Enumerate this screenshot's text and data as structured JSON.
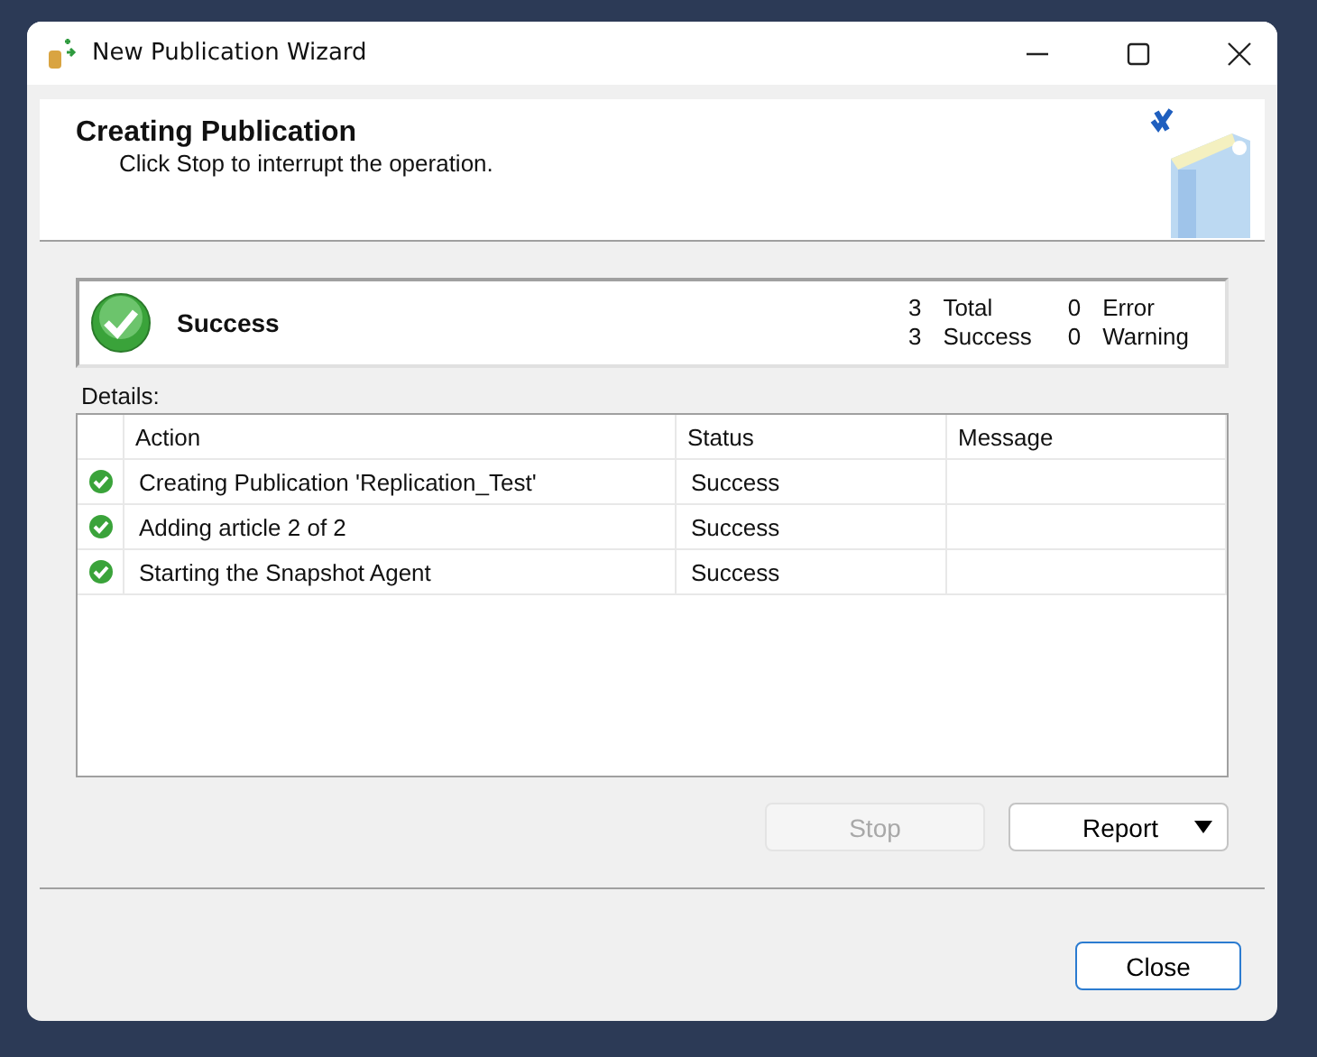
{
  "window": {
    "title": "New Publication Wizard"
  },
  "header": {
    "title": "Creating Publication",
    "subtitle": "Click Stop to interrupt the operation."
  },
  "summary": {
    "kind": "success",
    "label": "Success",
    "counts": [
      {
        "count": "3",
        "label": "Total"
      },
      {
        "count": "0",
        "label": "Error"
      },
      {
        "count": "3",
        "label": "Success"
      },
      {
        "count": "0",
        "label": "Warning"
      }
    ]
  },
  "details": {
    "label": "Details:",
    "columns": [
      "Action",
      "Status",
      "Message"
    ],
    "rows": [
      {
        "kind": "success",
        "action": "Creating Publication 'Replication_Test'",
        "result": "Success"
      },
      {
        "kind": "success",
        "action": "Adding article 2 of 2",
        "result": "Success"
      },
      {
        "kind": "success",
        "action": "Starting the Snapshot Agent",
        "result": "Success"
      }
    ]
  },
  "buttons": {
    "stop": {
      "label": "Stop",
      "disabled": true
    },
    "report": {
      "label": "Report",
      "disabled": false
    },
    "close": {
      "label": "Close",
      "disabled": false
    }
  }
}
